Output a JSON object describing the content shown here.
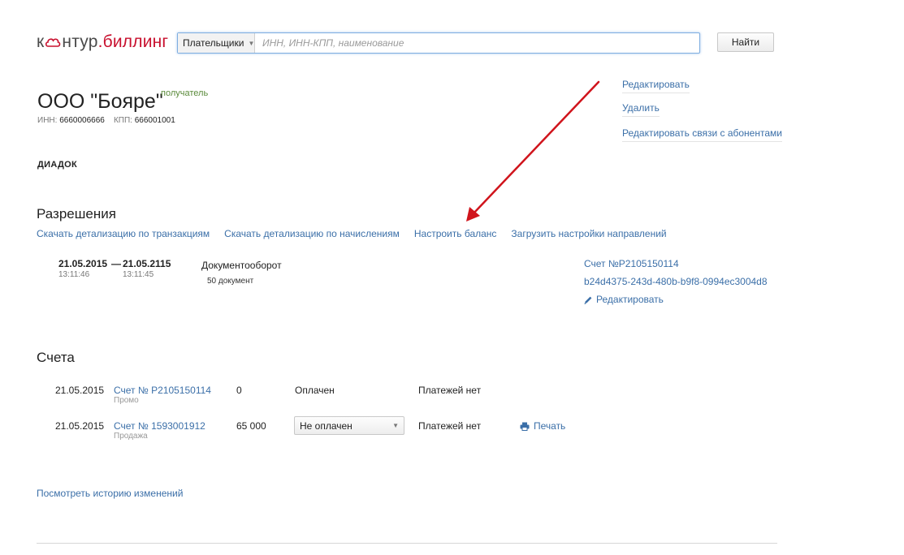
{
  "header": {
    "logo_prefix": "к",
    "logo_main": "нтур",
    "logo_suffix": ".биллинг",
    "scope_label": "Плательщики",
    "search_placeholder": "ИНН, ИНН-КПП, наименование",
    "find_label": "Найти"
  },
  "org": {
    "title": "ООО \"Бояре\"",
    "role": "получатель",
    "inn_label": "ИНН:",
    "inn": "6660006666",
    "kpp_label": "КПП:",
    "kpp": "666001001"
  },
  "side_links": {
    "edit": "Редактировать",
    "delete": "Удалить",
    "edit_relations": "Редактировать связи с абонентами"
  },
  "service": "ДИАДОК",
  "permissions": {
    "title": "Разрешения",
    "links": [
      "Скачать детализацию по транзакциям",
      "Скачать детализацию по начислениям",
      "Настроить баланс",
      "Загрузить настройки направлений"
    ],
    "item": {
      "date_from": "21.05.2015",
      "dash": "—",
      "date_to": "21.05.2115",
      "time_from": "13:11:46",
      "time_to": "13:11:45",
      "product": "Документооборот",
      "count": "50 документ",
      "bill": "Счет №Р2105150114",
      "guid": "b24d4375-243d-480b-b9f8-0994ec3004d8",
      "edit": "Редактировать"
    }
  },
  "bills": {
    "title": "Счета",
    "rows": [
      {
        "date": "21.05.2015",
        "number": "Счет № Р2105150114",
        "type": "Промо",
        "amount": "0",
        "status": "Оплачен",
        "payments": "Платежей нет"
      },
      {
        "date": "21.05.2015",
        "number": "Счет № 1593001912",
        "type": "Продажа",
        "amount": "65 000",
        "status": "Не оплачен",
        "payments": "Платежей нет",
        "print": "Печать"
      }
    ]
  },
  "history_link": "Посмотреть историю изменений",
  "colors": {
    "link": "#3b6fa8",
    "accent": "#c8102e",
    "role": "#5a8a3a",
    "annotation_arrow": "#d0141c"
  }
}
